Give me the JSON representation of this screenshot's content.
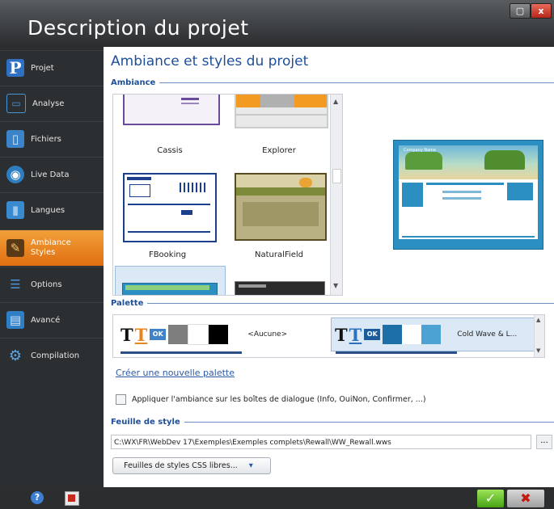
{
  "window": {
    "title": "Description du projet",
    "close_glyph": "x",
    "max_glyph": "▢"
  },
  "sidebar": {
    "items": [
      {
        "label": "Projet",
        "icon": "P"
      },
      {
        "label": "Analyse",
        "icon": "▭"
      },
      {
        "label": "Fichiers",
        "icon": "▯"
      },
      {
        "label": "Live Data",
        "icon": "◉"
      },
      {
        "label": "Langues",
        "icon": "▮"
      },
      {
        "label": "Ambiance Styles",
        "icon": "✎",
        "active": true
      },
      {
        "label": "Options",
        "icon": "☰"
      },
      {
        "label": "Avancé",
        "icon": "▤"
      },
      {
        "label": "Compilation",
        "icon": "⚙"
      }
    ]
  },
  "main": {
    "heading": "Ambiance et styles du projet",
    "ambiance_section": "Ambiance",
    "themes": [
      {
        "name": "Cassis"
      },
      {
        "name": "Explorer"
      },
      {
        "name": "FBooking"
      },
      {
        "name": "NaturalField"
      }
    ],
    "preview": {
      "company_label": "Company Name"
    },
    "palette_section": "Palette",
    "palettes": [
      {
        "label": "<Aucune>",
        "ok": "OK"
      },
      {
        "label": "Cold Wave & L...",
        "ok": "OK"
      }
    ],
    "palette_glyph": "T",
    "new_palette_link": "Créer une nouvelle palette",
    "apply_checkbox_label": "Appliquer l'ambiance sur les boîtes de dialogue (Info, OuiNon, Confirmer, ...)",
    "style_section": "Feuille de style",
    "style_path": "C:\\WX\\FR\\WebDev 17\\Exemples\\Exemples complets\\Rewall\\WW_Rewall.wws",
    "browse_label": "...",
    "css_button_label": "Feuilles de styles CSS libres...",
    "css_button_arrow": "▾"
  },
  "footer": {
    "ok_glyph": "✓",
    "cancel_glyph": "✖",
    "help_glyph": "?"
  },
  "colors": {
    "accent": "#e57613",
    "heading": "#1e4f98",
    "sidebar_bg": "#2c2f31"
  }
}
